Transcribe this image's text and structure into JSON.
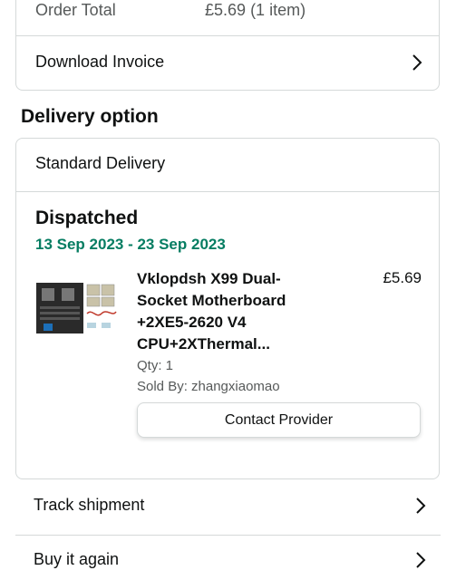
{
  "order_summary": {
    "order_total_label": "Order Total",
    "order_total_value": "£5.69",
    "order_total_items": "(1 item)",
    "download_invoice_label": "Download Invoice"
  },
  "delivery": {
    "heading": "Delivery option",
    "method": "Standard Delivery",
    "status": "Dispatched",
    "date_range": "13 Sep 2023 - 23 Sep 2023",
    "colors": {
      "date_green": "#067d62"
    }
  },
  "product": {
    "title_line1": "Vklopdsh X99 Dual-",
    "title_line2": "Socket Motherboard",
    "title_line3": "+2XE5-2620 V4",
    "title_line4": "CPU+2XThermal...",
    "price": "£5.69",
    "qty": "Qty: 1",
    "sold_by": "Sold By: zhangxiaomao",
    "contact_button": "Contact Provider"
  },
  "actions": {
    "track_shipment": "Track shipment",
    "buy_again": "Buy it again"
  }
}
